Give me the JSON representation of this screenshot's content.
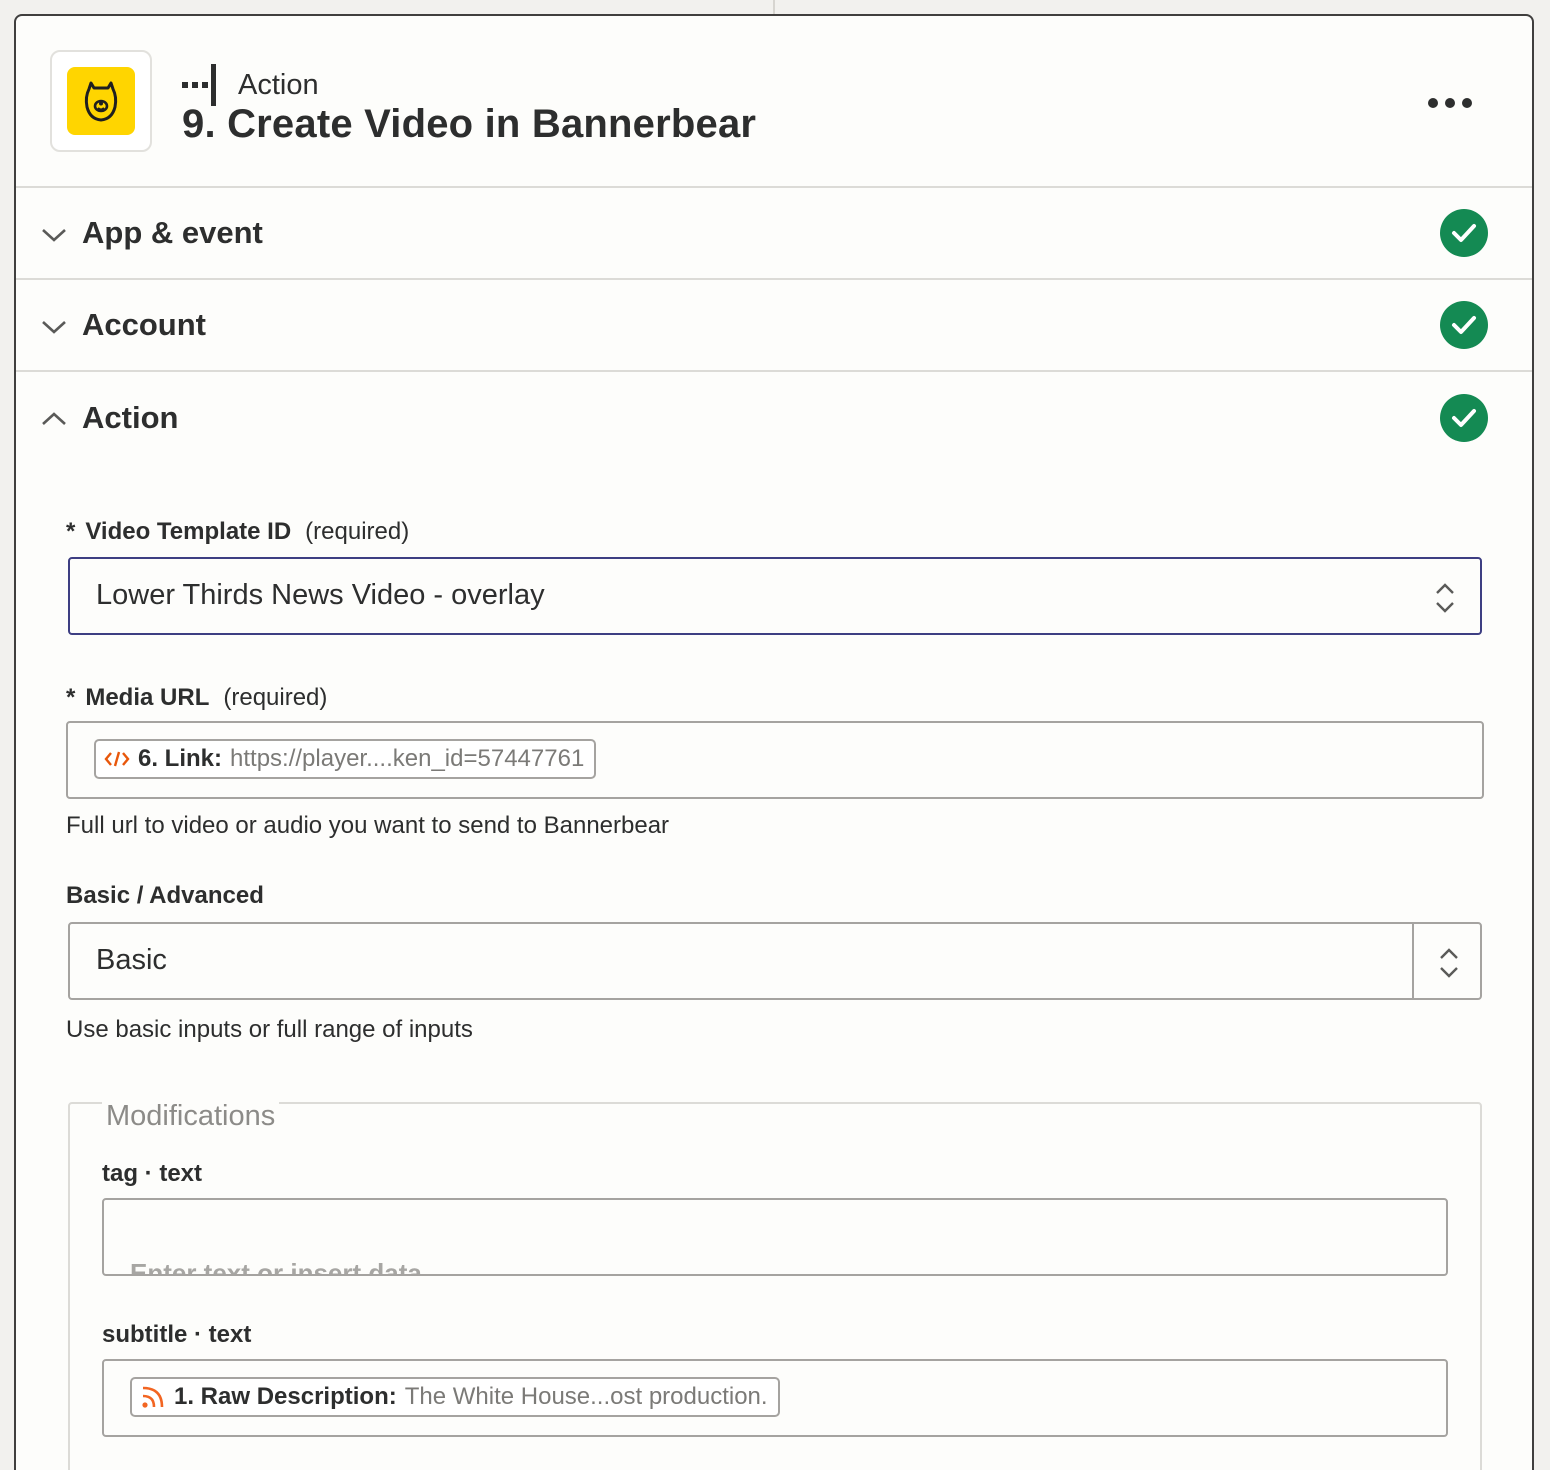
{
  "header": {
    "step_type": "Action",
    "step_title": "9. Create Video in Bannerbear"
  },
  "sections": [
    {
      "title": "App & event",
      "status": "complete"
    },
    {
      "title": "Account",
      "status": "complete"
    },
    {
      "title": "Action",
      "status": "complete"
    }
  ],
  "form": {
    "video_template": {
      "star": "*",
      "label": "Video Template ID",
      "required": "(required)",
      "value": "Lower Thirds News Video - overlay"
    },
    "media_url": {
      "star": "*",
      "label": "Media URL",
      "required": "(required)",
      "pill_label": "6. Link:",
      "pill_value": "https://player....ken_id=57447761",
      "help": "Full url to video or audio you want to send to Bannerbear"
    },
    "basic_advanced": {
      "label": "Basic / Advanced",
      "value": "Basic",
      "help": "Use basic inputs or full range of inputs"
    },
    "modifications": {
      "legend": "Modifications",
      "tag": {
        "label": "tag · text",
        "placeholder": "Enter text or insert data..."
      },
      "subtitle": {
        "label": "subtitle · text",
        "pill_label": "1. Raw Description:",
        "pill_value": "The White House...ost production."
      }
    }
  },
  "colors": {
    "check_green": "#148a53",
    "bannerbear_yellow": "#ffd500",
    "focus_border": "#3d3e82",
    "code_icon": "#e8570b",
    "rss_icon": "#f26522"
  }
}
